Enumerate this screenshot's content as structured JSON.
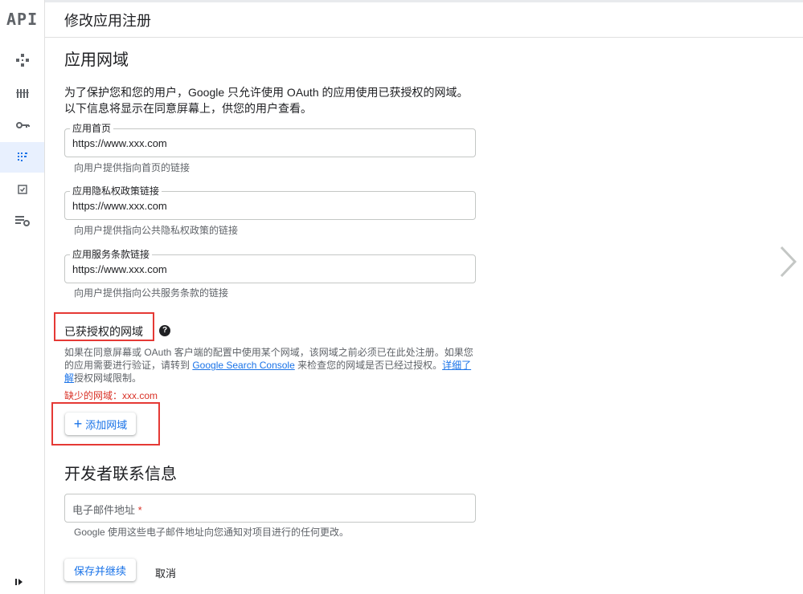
{
  "app": {
    "logo_text": "API"
  },
  "header": {
    "title": "修改应用注册"
  },
  "rail_icons": [
    {
      "name": "overview-icon"
    },
    {
      "name": "library-icon"
    },
    {
      "name": "key-icon"
    },
    {
      "name": "consent-screen-icon"
    },
    {
      "name": "agreements-icon"
    },
    {
      "name": "settings-list-icon"
    }
  ],
  "domain_section": {
    "title": "应用网域",
    "intro": "为了保护您和您的用户，Google 只允许使用 OAuth 的应用使用已获授权的网域。以下信息将显示在同意屏幕上，供您的用户查看。",
    "fields": [
      {
        "label": "应用首页",
        "value": "https://www.xxx.com",
        "hint": "向用户提供指向首页的链接"
      },
      {
        "label": "应用隐私权政策链接",
        "value": "https://www.xxx.com",
        "hint": "向用户提供指向公共隐私权政策的链接"
      },
      {
        "label": "应用服务条款链接",
        "value": "https://www.xxx.com",
        "hint": "向用户提供指向公共服务条款的链接"
      }
    ]
  },
  "authorized_domains": {
    "title": "已获授权的网域",
    "help_glyph": "?",
    "desc_1": "如果在同意屏幕或 OAuth 客户端的配置中使用某个网域，该网域之前必须已在此处注册。如果您的应用需要进行验证，请转到 ",
    "console_link": "Google Search Console",
    "desc_2": " 来检查您的网域是否已经过授权。",
    "learn_more": "详细了解",
    "desc_3": "授权网域限制。",
    "error": "缺少的网域：xxx.com",
    "add_button": "添加网域",
    "plus_glyph": "+"
  },
  "developer_section": {
    "title": "开发者联系信息",
    "email_placeholder": "电子邮件地址",
    "required_mark": "*",
    "hint": "Google 使用这些电子邮件地址向您通知对项目进行的任何更改。"
  },
  "actions": {
    "save": "保存并继续",
    "cancel": "取消"
  },
  "colors": {
    "accent": "#1a73e8",
    "error": "#d93025",
    "highlight_box": "#e53935"
  }
}
